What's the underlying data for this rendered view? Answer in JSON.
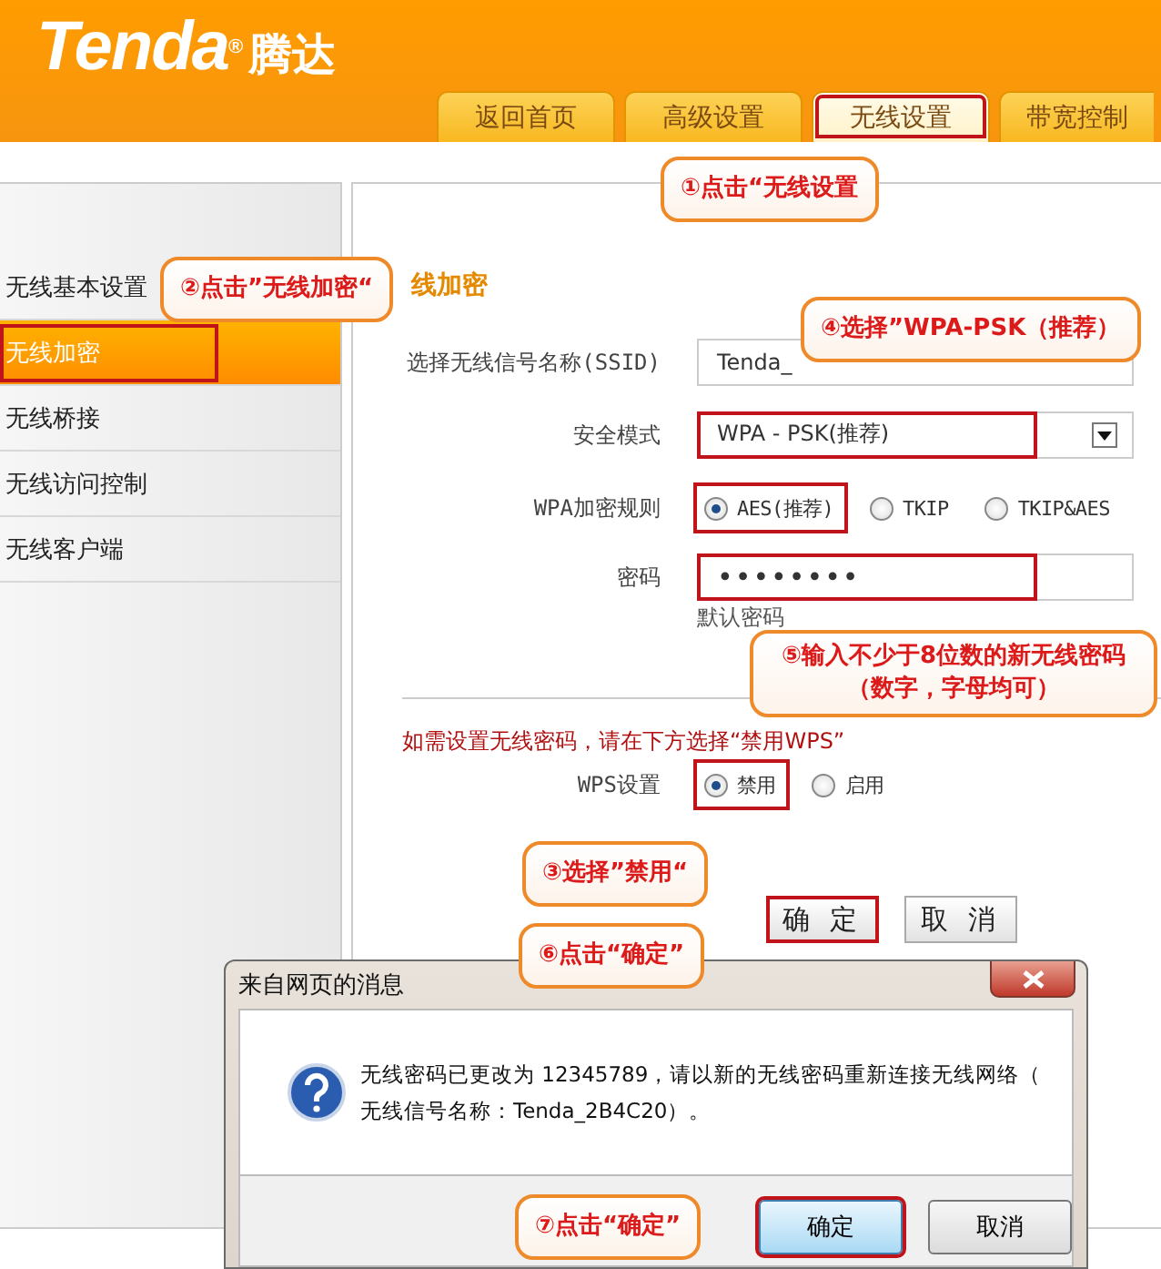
{
  "logo": {
    "brand": "Tenda$^{®}$",
    "name_cn": "腾达"
  },
  "tabs": [
    {
      "label": "返回首页",
      "selected": false,
      "highlighted": false
    },
    {
      "label": "高级设置",
      "selected": false,
      "highlighted": false
    },
    {
      "label": "无线设置",
      "selected": true,
      "highlighted": true
    },
    {
      "label": "带宽控制",
      "selected": false,
      "highlighted": false
    }
  ],
  "sidebar": {
    "items": [
      {
        "label": "无线基本设置",
        "selected": false,
        "highlighted": false
      },
      {
        "label": "无线加密",
        "selected": true,
        "highlighted": true
      },
      {
        "label": "无线桥接",
        "selected": false,
        "highlighted": false
      },
      {
        "label": "无线访问控制",
        "selected": false,
        "highlighted": false
      },
      {
        "label": "无线客户端",
        "selected": false,
        "highlighted": false
      }
    ]
  },
  "form": {
    "title": "线加密",
    "ssid": {
      "label": "选择无线信号名称(SSID)",
      "value": "Tenda_"
    },
    "security_mode": {
      "label": "安全模式",
      "value": "WPA - PSK(推荐)",
      "highlighted": true
    },
    "cipher": {
      "label": "WPA加密规则",
      "options": [
        {
          "label": "AES(推荐)",
          "selected": true,
          "highlighted": true
        },
        {
          "label": "TKIP",
          "selected": false,
          "highlighted": false
        },
        {
          "label": "TKIP&AES",
          "selected": false,
          "highlighted": false
        }
      ]
    },
    "password": {
      "label": "密码",
      "value": "••••••••",
      "highlighted": true
    },
    "password_hint": "默认密码",
    "wps_notice": "如需设置无线密码，请在下方选择“禁用WPS”",
    "wps": {
      "label": "WPS设置",
      "options": [
        {
          "label": "禁用",
          "selected": true,
          "highlighted": true
        },
        {
          "label": "启用",
          "selected": false,
          "highlighted": false
        }
      ]
    },
    "buttons": [
      {
        "label": "确 定",
        "highlighted": true
      },
      {
        "label": "取 消",
        "highlighted": false
      }
    ]
  },
  "callouts": [
    {
      "text": "①点击“无线设置"
    },
    {
      "text": "②点击”无线加密“"
    },
    {
      "text": "④选择”WPA-PSK（推荐）"
    },
    {
      "text": "⑤输入不少于8位数的新无线密码（数字，字母均可）"
    },
    {
      "text": "③选择”禁用“"
    },
    {
      "text": "⑥点击“确定”"
    },
    {
      "text": "⑦点击“确定”"
    }
  ],
  "dialog": {
    "title": "来自网页的消息",
    "message_lines": [
      "无线密码已更改为 12345789，请以新的无线密码重新连接无线网络（",
      "无线信号名称：Tenda_2B4C20）。"
    ],
    "buttons": [
      {
        "label": "确定",
        "highlighted": true
      },
      {
        "label": "取消",
        "highlighted": false
      }
    ]
  }
}
